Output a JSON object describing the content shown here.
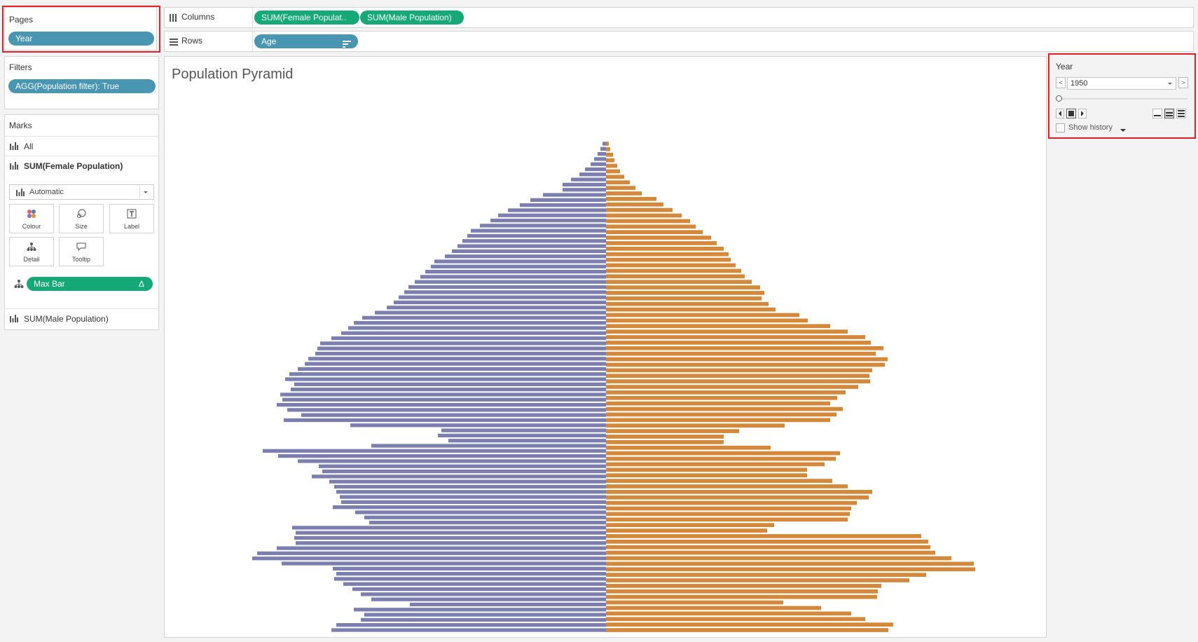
{
  "pages": {
    "title": "Pages",
    "pill": "Year"
  },
  "filters": {
    "title": "Filters",
    "pill": "AGG(Population filter): True"
  },
  "marks": {
    "title": "Marks",
    "all": "All",
    "female": "SUM(Female Population)",
    "mark_type": "Automatic",
    "tiles": {
      "colour": "Colour",
      "size": "Size",
      "label": "Label",
      "detail": "Detail",
      "tooltip": "Tooltip"
    },
    "max_bar": "Max Bar",
    "max_bar_glyph": "Δ",
    "male": "SUM(Male Population)"
  },
  "columns_shelf": {
    "label": "Columns",
    "pills": [
      "SUM(Female Populat..",
      "SUM(Male Population)"
    ]
  },
  "rows_shelf": {
    "label": "Rows",
    "pill": "Age"
  },
  "view": {
    "title": "Population Pyramid"
  },
  "year_control": {
    "title": "Year",
    "value": "1950",
    "prev": "<",
    "next": ">",
    "show_history": "Show history"
  },
  "colors": {
    "female": "#7a7fb0",
    "male": "#d4883a",
    "pill_blue": "#4996b2",
    "pill_green": "#16a978",
    "highlight": "#e0202a"
  },
  "chart_data": {
    "type": "bar",
    "orientation": "horizontal-diverging",
    "series": [
      {
        "name": "SUM(Female Population)",
        "color": "#7a7fb0",
        "values": [
          5,
          8,
          12,
          17,
          22,
          30,
          38,
          50,
          62,
          62,
          90,
          108,
          123,
          140,
          154,
          165,
          180,
          193,
          198,
          205,
          212,
          220,
          230,
          245,
          250,
          258,
          265,
          273,
          282,
          288,
          296,
          303,
          313,
          330,
          348,
          360,
          368,
          378,
          392,
          408,
          412,
          415,
          425,
          430,
          440,
          452,
          458,
          445,
          450,
          465,
          462,
          470,
          455,
          435,
          460,
          365,
          235,
          240,
          225,
          335,
          490,
          468,
          440,
          410,
          405,
          420,
          395,
          388,
          385,
          380,
          378,
          390,
          358,
          345,
          338,
          448,
          443,
          445,
          443,
          470,
          498,
          505,
          463,
          390,
          385,
          388,
          375,
          362,
          350,
          335,
          280,
          360,
          345,
          350,
          385,
          392
        ]
      },
      {
        "name": "SUM(Male Population)",
        "color": "#d4883a",
        "values": [
          4,
          6,
          10,
          12,
          16,
          20,
          26,
          34,
          42,
          51,
          72,
          82,
          95,
          108,
          120,
          128,
          138,
          150,
          158,
          168,
          175,
          178,
          185,
          193,
          198,
          208,
          220,
          226,
          222,
          232,
          242,
          276,
          288,
          320,
          345,
          370,
          378,
          396,
          385,
          402,
          398,
          380,
          376,
          377,
          360,
          342,
          330,
          320,
          338,
          329,
          320,
          255,
          190,
          168,
          168,
          235,
          334,
          328,
          312,
          287,
          287,
          323,
          345,
          380,
          375,
          358,
          350,
          348,
          345,
          240,
          230,
          450,
          460,
          463,
          470,
          493,
          525,
          527,
          457,
          433,
          393,
          388,
          387,
          253,
          307,
          350,
          370,
          410,
          403
        ]
      }
    ]
  }
}
